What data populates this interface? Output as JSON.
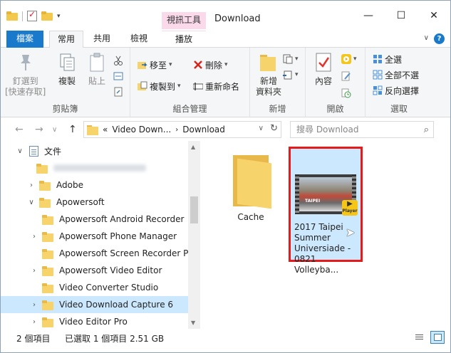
{
  "window": {
    "title": "Download",
    "context_tab_header": "視訊工具",
    "controls": {
      "minimize": "—",
      "maximize": "☐",
      "close": "✕"
    }
  },
  "ribbon_tabs": [
    {
      "label": "檔案"
    },
    {
      "label": "常用"
    },
    {
      "label": "共用"
    },
    {
      "label": "檢視"
    },
    {
      "label": "播放"
    }
  ],
  "ribbon": {
    "clipboard": {
      "label": "剪貼簿",
      "pin_line1": "釘選到",
      "pin_line2": "[快速存取]",
      "copy": "複製",
      "paste": "貼上"
    },
    "organize": {
      "label": "組合管理",
      "move_to": "移至",
      "copy_to": "複製到",
      "delete": "刪除",
      "rename": "重新命名"
    },
    "new": {
      "label": "新增",
      "new_folder_line1": "新增",
      "new_folder_line2": "資料夾"
    },
    "open": {
      "label": "開啟",
      "properties": "內容"
    },
    "select": {
      "label": "選取",
      "select_all": "全選",
      "select_none": "全部不選",
      "invert": "反向選擇"
    }
  },
  "address": {
    "prefix": "«",
    "path_segments": [
      "Video Down...",
      "Download"
    ],
    "search_placeholder": "搜尋 Download"
  },
  "nav_tree": [
    {
      "label": "文件",
      "type": "doc",
      "expanded": true
    },
    {
      "label": "",
      "type": "blurred"
    },
    {
      "label": "Adobe",
      "type": "folder"
    },
    {
      "label": "Apowersoft",
      "type": "folder",
      "expanded": true
    },
    {
      "label": "Apowersoft Android Recorder",
      "type": "folder"
    },
    {
      "label": "Apowersoft Phone Manager",
      "type": "folder"
    },
    {
      "label": "Apowersoft Screen Recorder Pro",
      "type": "folder"
    },
    {
      "label": "Apowersoft Video Editor",
      "type": "folder"
    },
    {
      "label": "Video Converter Studio",
      "type": "folder"
    },
    {
      "label": "Video Download Capture 6",
      "type": "folder",
      "selected": true
    },
    {
      "label": "Video Editor Pro",
      "type": "folder"
    }
  ],
  "files": [
    {
      "name": "Cache",
      "type": "folder"
    },
    {
      "name": "2017 Taipei Summer Universiade - 0821 Volleyba...",
      "type": "video",
      "selected": true,
      "badge": "Player",
      "thumb_text": "TAIPEI"
    }
  ],
  "status": {
    "item_count": "2 個項目",
    "selection": "已選取 1 個項目  2.51 GB"
  },
  "colors": {
    "accent": "#1979ca",
    "selection": "#cce8ff",
    "highlight_border": "#e51b1b",
    "context_tab": "#f9d9ea",
    "folder": "#f7d36c"
  }
}
